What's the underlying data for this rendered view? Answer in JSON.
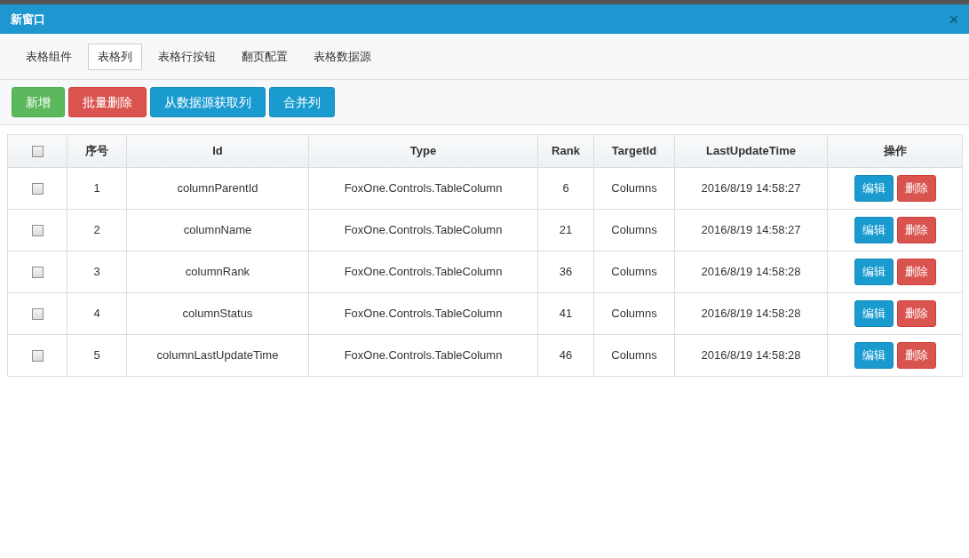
{
  "window": {
    "title": "新窗口",
    "close": "×"
  },
  "tabs": [
    {
      "label": "表格组件",
      "selected": false
    },
    {
      "label": "表格列",
      "selected": true
    },
    {
      "label": "表格行按钮",
      "selected": false
    },
    {
      "label": "翻页配置",
      "selected": false
    },
    {
      "label": "表格数据源",
      "selected": false
    }
  ],
  "toolbar": [
    {
      "label": "新增",
      "kind": "success"
    },
    {
      "label": "批量删除",
      "kind": "danger"
    },
    {
      "label": "从数据源获取列",
      "kind": "info"
    },
    {
      "label": "合并列",
      "kind": "info"
    }
  ],
  "table": {
    "select_all_checked": false,
    "columns": [
      "序号",
      "Id",
      "Type",
      "Rank",
      "TargetId",
      "LastUpdateTime",
      "操作"
    ],
    "rows": [
      {
        "checked": false,
        "cells": [
          "1",
          "columnParentId",
          "FoxOne.Controls.TableColumn",
          "6",
          "Columns",
          "2016/8/19 14:58:27"
        ],
        "actions": [
          {
            "label": "编辑",
            "kind": "info"
          },
          {
            "label": "删除",
            "kind": "danger"
          }
        ]
      },
      {
        "checked": false,
        "cells": [
          "2",
          "columnName",
          "FoxOne.Controls.TableColumn",
          "21",
          "Columns",
          "2016/8/19 14:58:27"
        ],
        "actions": [
          {
            "label": "编辑",
            "kind": "info"
          },
          {
            "label": "删除",
            "kind": "danger"
          }
        ]
      },
      {
        "checked": false,
        "cells": [
          "3",
          "columnRank",
          "FoxOne.Controls.TableColumn",
          "36",
          "Columns",
          "2016/8/19 14:58:28"
        ],
        "actions": [
          {
            "label": "编辑",
            "kind": "info"
          },
          {
            "label": "删除",
            "kind": "danger"
          }
        ]
      },
      {
        "checked": false,
        "cells": [
          "4",
          "columnStatus",
          "FoxOne.Controls.TableColumn",
          "41",
          "Columns",
          "2016/8/19 14:58:28"
        ],
        "actions": [
          {
            "label": "编辑",
            "kind": "info"
          },
          {
            "label": "删除",
            "kind": "danger"
          }
        ]
      },
      {
        "checked": false,
        "cells": [
          "5",
          "columnLastUpdateTime",
          "FoxOne.Controls.TableColumn",
          "46",
          "Columns",
          "2016/8/19 14:58:28"
        ],
        "actions": [
          {
            "label": "编辑",
            "kind": "info"
          },
          {
            "label": "删除",
            "kind": "danger"
          }
        ]
      }
    ]
  }
}
